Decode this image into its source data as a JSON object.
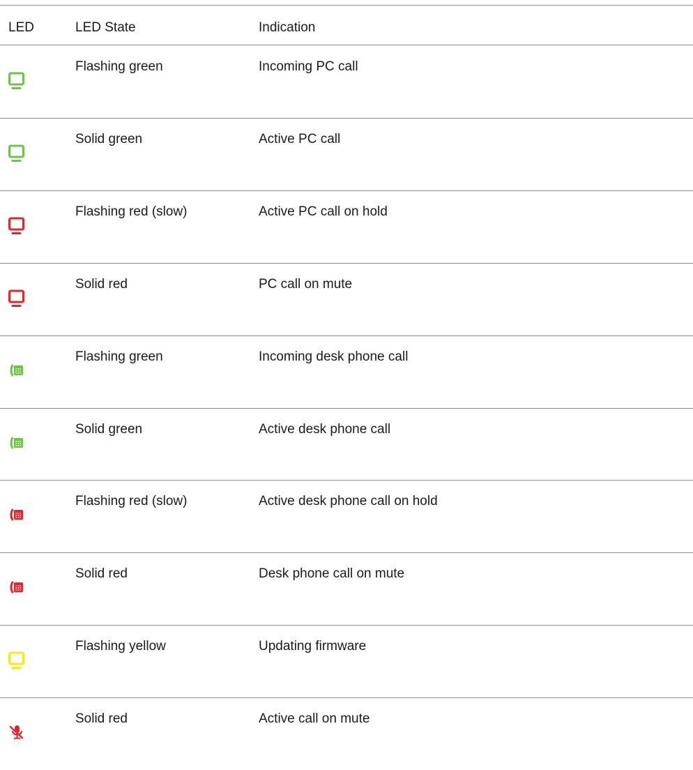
{
  "table": {
    "headers": {
      "led": "LED",
      "state": "LED State",
      "indication": "Indication"
    },
    "rows": [
      {
        "icon": "pc-monitor-icon",
        "color": "#6cc644",
        "state": "Flashing green",
        "indication": "Incoming PC call"
      },
      {
        "icon": "pc-monitor-icon",
        "color": "#6cc644",
        "state": "Solid green",
        "indication": "Active PC call"
      },
      {
        "icon": "pc-monitor-icon",
        "color": "#e8232a",
        "state": "Flashing red (slow)",
        "indication": "Active PC call on hold"
      },
      {
        "icon": "pc-monitor-icon",
        "color": "#e8232a",
        "state": "Solid red",
        "indication": "PC call on mute"
      },
      {
        "icon": "desk-phone-icon",
        "color": "#6cc644",
        "state": "Flashing green",
        "indication": "Incoming desk phone call"
      },
      {
        "icon": "desk-phone-icon",
        "color": "#6cc644",
        "state": "Solid green",
        "indication": "Active desk phone call"
      },
      {
        "icon": "desk-phone-icon",
        "color": "#e8232a",
        "state": "Flashing red (slow)",
        "indication": "Active desk phone call on hold"
      },
      {
        "icon": "desk-phone-icon",
        "color": "#e8232a",
        "state": "Solid red",
        "indication": "Desk phone call on mute"
      },
      {
        "icon": "pc-monitor-icon",
        "color": "#f2ea1a",
        "state": "Flashing yellow",
        "indication": "Updating firmware"
      },
      {
        "icon": "mute-microphone-icon",
        "color": "#e8232a",
        "state": "Solid red",
        "indication": "Active call on mute"
      }
    ]
  }
}
